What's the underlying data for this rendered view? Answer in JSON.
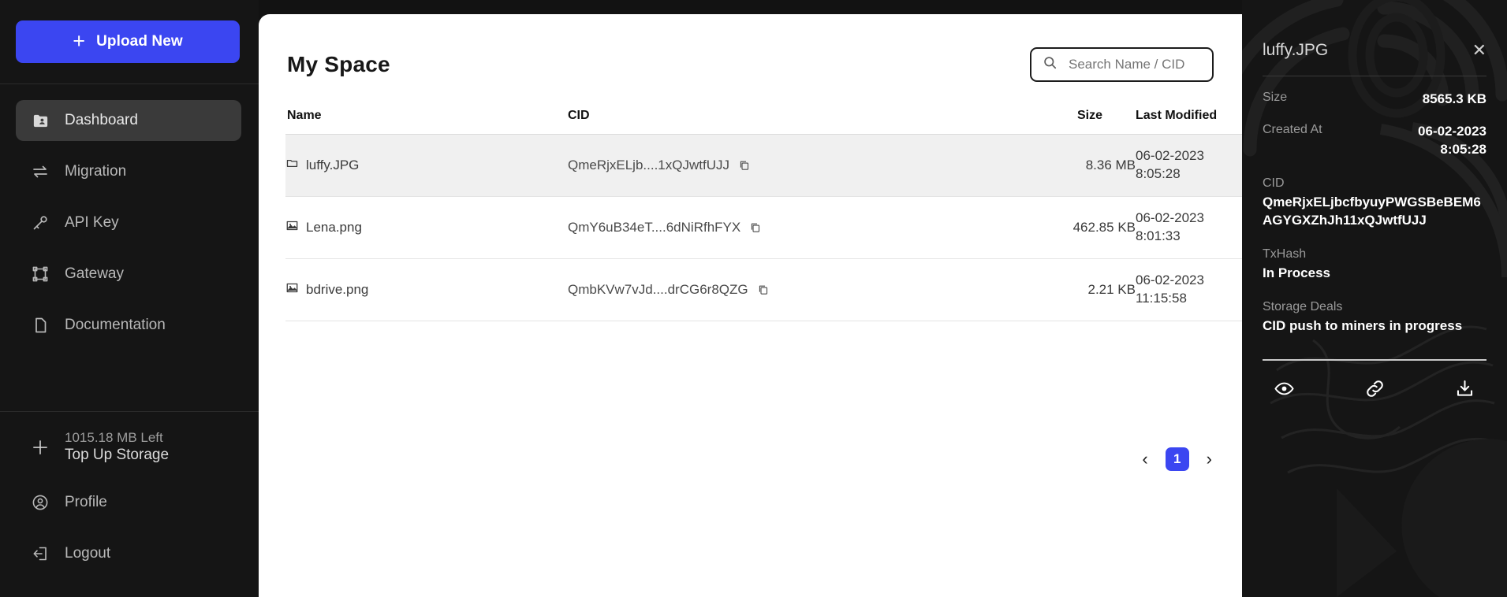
{
  "sidebar": {
    "upload_button": {
      "label": "Upload New",
      "icon": "plus-icon",
      "color": "#3b46f1"
    },
    "items": [
      {
        "label": "Dashboard",
        "icon": "folder-user-icon",
        "active": true
      },
      {
        "label": "Migration",
        "icon": "transfer-arrows-icon",
        "active": false
      },
      {
        "label": "API Key",
        "icon": "key-icon",
        "active": false
      },
      {
        "label": "Gateway",
        "icon": "frame-nodes-icon",
        "active": false
      },
      {
        "label": "Documentation",
        "icon": "document-icon",
        "active": false
      }
    ],
    "storage": {
      "icon": "plus-icon",
      "left_label": "1015.18 MB Left",
      "action_label": "Top Up Storage"
    },
    "account": [
      {
        "label": "Profile",
        "icon": "user-circle-icon"
      },
      {
        "label": "Logout",
        "icon": "logout-icon"
      }
    ]
  },
  "main": {
    "title": "My Space",
    "search": {
      "placeholder": "Search Name / CID",
      "value": "",
      "icon": "search-icon"
    },
    "table": {
      "headers": [
        "Name",
        "CID",
        "Size",
        "Last Modified"
      ],
      "rows": [
        {
          "icon": "folder-icon",
          "name": "luffy.JPG",
          "cid": "QmeRjxELjb....1xQJwtfUJJ",
          "copy_icon": "copy-icon",
          "size": "8.36 MB",
          "modified_date": "06-02-2023",
          "modified_time": "8:05:28",
          "selected": true
        },
        {
          "icon": "image-icon",
          "name": "Lena.png",
          "cid": "QmY6uB34eT....6dNiRfhFYX",
          "copy_icon": "copy-icon",
          "size": "462.85 KB",
          "modified_date": "06-02-2023",
          "modified_time": "8:01:33",
          "selected": false
        },
        {
          "icon": "image-icon",
          "name": "bdrive.png",
          "cid": "QmbKVw7vJd....drCG6r8QZG",
          "copy_icon": "copy-icon",
          "size": "2.21 KB",
          "modified_date": "06-02-2023",
          "modified_time": "11:15:58",
          "selected": false
        }
      ]
    },
    "pagination": {
      "prev": "‹",
      "current": "1",
      "next": "›",
      "active_color": "#3b46f1"
    }
  },
  "detail": {
    "title": "luffy.JPG",
    "close_icon": "close-icon",
    "size_label": "Size",
    "size_value": "8565.3 KB",
    "created_label": "Created At",
    "created_date": "06-02-2023",
    "created_time": "8:05:28",
    "cid_label": "CID",
    "cid_value": "QmeRjxELjbcfbyuyPWGSBeBEM6AGYGXZhJh11xQJwtfUJJ",
    "txhash_label": "TxHash",
    "txhash_value": "In Process",
    "deals_label": "Storage Deals",
    "deals_value": "CID push to miners in progress",
    "actions": [
      {
        "name": "view",
        "icon": "eye-icon"
      },
      {
        "name": "copy-link",
        "icon": "link-icon"
      },
      {
        "name": "download",
        "icon": "download-icon"
      }
    ]
  }
}
